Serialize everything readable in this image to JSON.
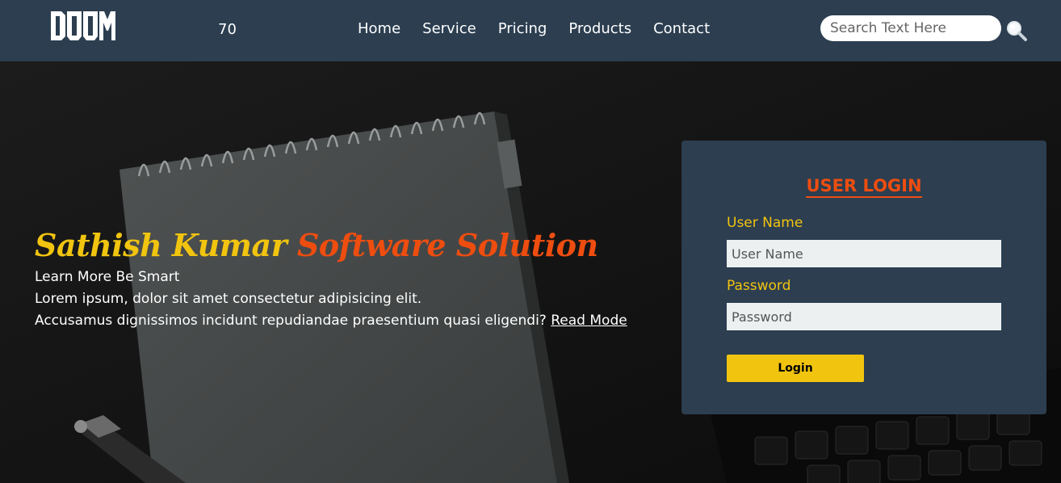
{
  "navbar": {
    "logo_text": "DOOM",
    "counter": "70",
    "links": [
      "Home",
      "Service",
      "Pricing",
      "Products",
      "Contact"
    ],
    "search_placeholder": "Search Text Here"
  },
  "hero": {
    "title_part1": "Sathish Kumar",
    "title_part2": "Software Solution",
    "line1": "Learn More Be Smart",
    "line2": "Lorem ipsum, dolor sit amet consectetur adipisicing elit.",
    "line3": "Accusamus dignissimos incidunt repudiandae praesentium quasi eligendi?",
    "read_more": "Read Mode"
  },
  "login": {
    "title": "USER LOGIN",
    "username_label": "User Name",
    "username_placeholder": "User Name",
    "password_label": "Password",
    "password_placeholder": "Password",
    "button": "Login"
  },
  "colors": {
    "navbar_bg": "#2c3e50",
    "accent_yellow": "#f1c40f",
    "accent_orange": "#ee4d10",
    "input_bg": "#ecf0f1"
  },
  "icons": {
    "logo": "doom-logo",
    "search": "magnifier-icon"
  }
}
